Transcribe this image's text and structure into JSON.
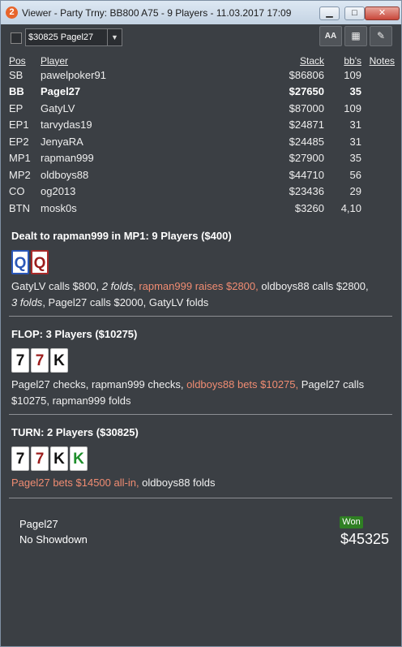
{
  "window": {
    "app_icon": "2",
    "title": "Viewer - Party Trny: BB800 A75 - 9 Players - 11.03.2017 17:09",
    "minimize_icon": "minimize-icon",
    "maximize_icon": "maximize-icon",
    "close_icon": "close-icon"
  },
  "toolbar": {
    "hand_select_value": "$30825 Pagel27",
    "caret": "▼",
    "font_button": "AA",
    "grid_button": "▦",
    "edit_button": "✎"
  },
  "table": {
    "headers": {
      "pos": "Pos",
      "player": "Player",
      "stack": "Stack",
      "bb": "bb's",
      "notes": "Notes"
    },
    "rows": [
      {
        "pos": "SB",
        "player": "pawelpoker91",
        "stack": "$86806",
        "bb": "109"
      },
      {
        "pos": "BB",
        "player": "Pagel27",
        "stack": "$27650",
        "bb": "35"
      },
      {
        "pos": "EP",
        "player": "GatyLV",
        "stack": "$87000",
        "bb": "109"
      },
      {
        "pos": "EP1",
        "player": "tarvydas19",
        "stack": "$24871",
        "bb": "31"
      },
      {
        "pos": "EP2",
        "player": "JenyaRA",
        "stack": "$24485",
        "bb": "31"
      },
      {
        "pos": "MP1",
        "player": "rapman999",
        "stack": "$27900",
        "bb": "35"
      },
      {
        "pos": "MP2",
        "player": "oldboys88",
        "stack": "$44710",
        "bb": "56"
      },
      {
        "pos": "CO",
        "player": "og2013",
        "stack": "$23436",
        "bb": "29"
      },
      {
        "pos": "BTN",
        "player": "mosk0s",
        "stack": "$3260",
        "bb": "4,10"
      }
    ]
  },
  "preflop": {
    "title": "Dealt to rapman999 in MP1: 9 Players ($400)",
    "cards": [
      "Q",
      "Q"
    ],
    "a1": "GatyLV calls $800, ",
    "a2": "2 folds",
    "a3": ", ",
    "a4": "rapman999 raises $2800,",
    "a5": " oldboys88 calls $2800,",
    "a6": "3 folds",
    "a7": ", Pagel27 calls $2000, GatyLV folds"
  },
  "flop": {
    "title": "FLOP: 3 Players ($10275)",
    "cards": [
      "7",
      "7",
      "K"
    ],
    "a1": "Pagel27 checks, rapman999 checks, ",
    "a2": "oldboys88 bets $10275,",
    "a3": " Pagel27 calls $10275, rapman999 folds"
  },
  "turn": {
    "title": "TURN: 2 Players ($30825)",
    "cards": [
      "7",
      "7",
      "K",
      "K"
    ],
    "a1": "Pagel27 bets $14500 all-in,",
    "a2": " oldboys88 folds"
  },
  "result": {
    "player": "Pagel27",
    "showdown": "No Showdown",
    "badge": "Won",
    "amount": "$45325"
  }
}
